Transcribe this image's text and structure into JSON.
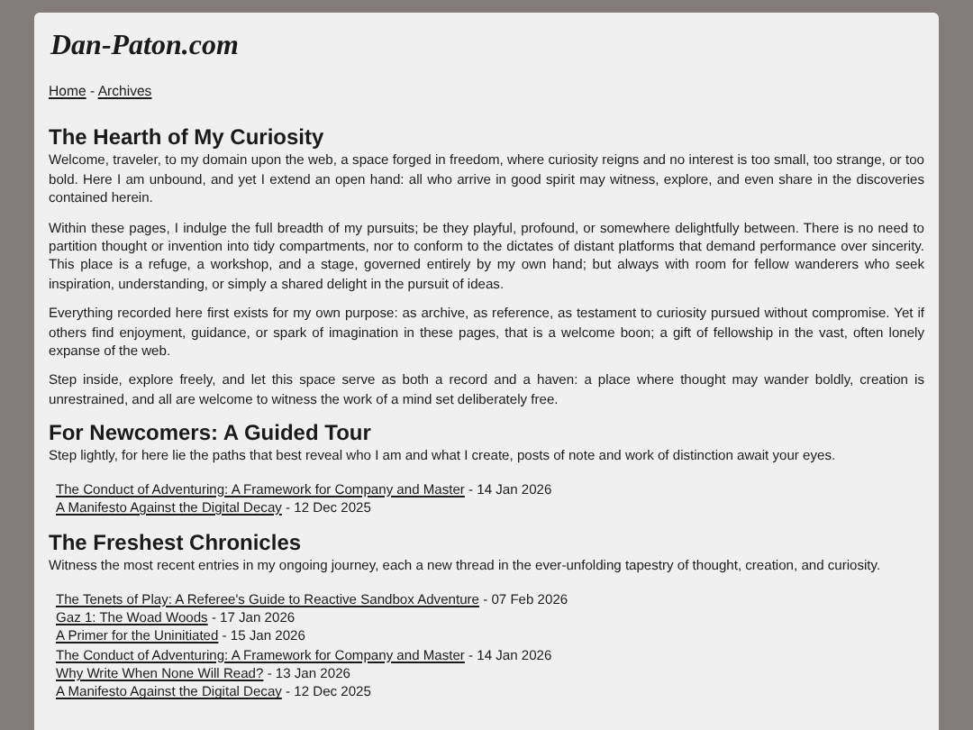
{
  "site_title": "Dan-Paton.com",
  "breadcrumb": [
    {
      "label": "Home"
    },
    {
      "label": "Archives"
    }
  ],
  "breadcrumb_separator": "-",
  "sections": [
    {
      "heading": "The Hearth of My Curiosity",
      "paragraphs": [
        "Welcome, traveler, to my domain upon the web, a space forged in freedom, where curiosity reigns and no interest is too small, too strange, or too bold. Here I am unbound, and yet I extend an open hand: all who arrive in good spirit may witness, explore, and even share in the discoveries contained herein.",
        "Within these pages, I indulge the full breadth of my pursuits; be they playful, profound, or somewhere delightfully between. There is no need to partition thought or invention into tidy compartments, nor to conform to the dictates of distant platforms that demand performance over sincerity. This place is a refuge, a workshop, and a stage, governed entirely by my own hand; but always with room for fellow wanderers who seek inspiration, understanding, or simply a shared delight in the pursuit of ideas.",
        "Everything recorded here first exists for my own purpose: as archive, as reference, as testament to curiosity pursued without compromise. Yet if others find enjoyment, guidance, or spark of imagination in these pages, that is a welcome boon; a gift of fellowship in the vast, often lonely expanse of the web.",
        "Step inside, explore freely, and let this space serve as both a record and a haven: a place where thought may wander boldly, creation is unrestrained, and all are welcome to witness the work of a mind set deliberately free."
      ]
    },
    {
      "heading": "For Newcomers: A Guided Tour",
      "paragraphs": [
        "Step lightly, for here lie the paths that best reveal who I am and what I create, posts of note and work of distinction await your eyes."
      ],
      "posts": [
        {
          "title": "The Conduct of Adventuring: A Framework for Company and Master",
          "date": "- 14 Jan 2026"
        },
        {
          "title": "A Manifesto Against the Digital Decay",
          "date": "- 12 Dec 2025"
        }
      ]
    },
    {
      "heading": "The Freshest Chronicles",
      "paragraphs": [
        "Witness the most recent entries in my ongoing journey, each a new thread in the ever-unfolding tapestry of thought, creation, and curiosity."
      ],
      "posts": [
        {
          "title": "The Tenets of Play: A Referee's Guide to Reactive Sandbox Adventure",
          "date": "- 07 Feb 2026"
        },
        {
          "title": "Gaz 1: The Woad Woods",
          "date": "- 17 Jan 2026"
        },
        {
          "title": "A Primer for the Uninitiated",
          "date": "- 15 Jan 2026"
        },
        {
          "title": "The Conduct of Adventuring: A Framework for Company and Master",
          "date": "- 14 Jan 2026"
        },
        {
          "title": "Why Write When None Will Read?",
          "date": "- 13 Jan 2026"
        },
        {
          "title": "A Manifesto Against the Digital Decay",
          "date": "- 12 Dec 2025"
        }
      ]
    }
  ]
}
